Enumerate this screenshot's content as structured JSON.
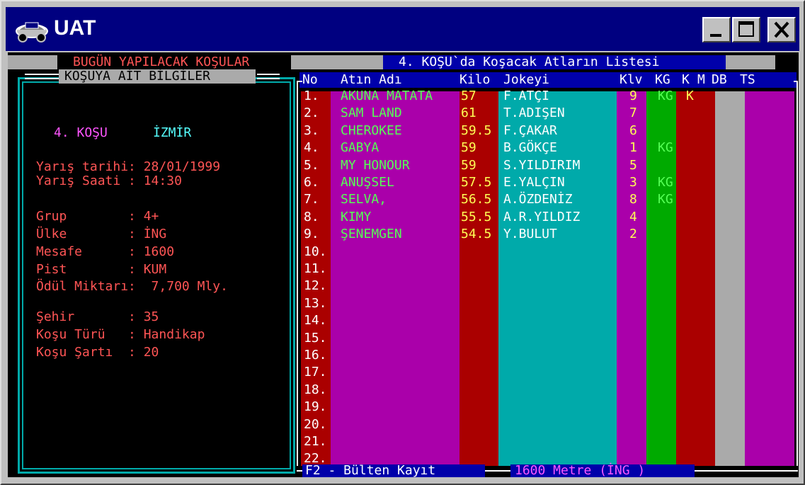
{
  "window": {
    "title": "UAT",
    "icon": "race-car-icon"
  },
  "controls": {
    "minimize_icon": "minimize-icon",
    "maximize_icon": "maximize-icon",
    "close_icon": "close-icon"
  },
  "left": {
    "header": "BUGÜN YAPILACAK KOŞULAR",
    "box_title": "KOŞUYA AİT BİLGİLER",
    "race_no": "4. KOŞU",
    "city": "İZMİR",
    "lines": [
      "Yarış tarihi: 28/01/1999",
      "Yarış Saati : 14:30",
      "",
      "Grup        : 4+",
      "Ülke        : İNG",
      "Mesafe      : 1600",
      "Pist        : KUM",
      "Ödül Miktarı:  7,700 Mly.",
      "",
      "Şehir       : 35",
      "Koşu Türü   : Handikap",
      "Koşu Şartı  : 20"
    ]
  },
  "right": {
    "header": "4. KOŞU`da Koşacak Atların Listesi",
    "columns": {
      "no": "No",
      "name": "Atın Adı",
      "kilo": "Kilo",
      "jockey": "Jokeyi",
      "klv": "Klv",
      "kg": "KG",
      "k": "K",
      "m": "M",
      "db": "DB",
      "ts": "TS"
    },
    "rows": [
      {
        "no": "1.",
        "name": "AKUNA MATATA",
        "kilo": "57",
        "jockey": "F.ATÇI",
        "klv": "9",
        "kg": "KG",
        "k": "K"
      },
      {
        "no": "2.",
        "name": "SAM LAND",
        "kilo": "61",
        "jockey": "T.ADIŞEN",
        "klv": "7",
        "kg": "",
        "k": ""
      },
      {
        "no": "3.",
        "name": "CHEROKEE",
        "kilo": "59.5",
        "jockey": "F.ÇAKAR",
        "klv": "6",
        "kg": "",
        "k": ""
      },
      {
        "no": "4.",
        "name": "GABYA",
        "kilo": "59",
        "jockey": "B.GÖKÇE",
        "klv": "1",
        "kg": "KG",
        "k": ""
      },
      {
        "no": "5.",
        "name": "MY HONOUR",
        "kilo": "59",
        "jockey": "S.YILDIRIM",
        "klv": "5",
        "kg": "",
        "k": ""
      },
      {
        "no": "6.",
        "name": "ANUŞSEL",
        "kilo": "57.5",
        "jockey": "E.YALÇIN",
        "klv": "3",
        "kg": "KG",
        "k": ""
      },
      {
        "no": "7.",
        "name": "SELVA,",
        "kilo": "56.5",
        "jockey": "A.ÖZDENİZ",
        "klv": "8",
        "kg": "KG",
        "k": ""
      },
      {
        "no": "8.",
        "name": "KIMY",
        "kilo": "55.5",
        "jockey": "A.R.YILDIZ",
        "klv": "4",
        "kg": "",
        "k": ""
      },
      {
        "no": "9.",
        "name": "ŞENEMGEN",
        "kilo": "54.5",
        "jockey": "Y.BULUT",
        "klv": "2",
        "kg": "",
        "k": ""
      },
      {
        "no": "10.",
        "name": "",
        "kilo": "",
        "jockey": "",
        "klv": "",
        "kg": "",
        "k": ""
      },
      {
        "no": "11.",
        "name": "",
        "kilo": "",
        "jockey": "",
        "klv": "",
        "kg": "",
        "k": ""
      },
      {
        "no": "12.",
        "name": "",
        "kilo": "",
        "jockey": "",
        "klv": "",
        "kg": "",
        "k": ""
      },
      {
        "no": "13.",
        "name": "",
        "kilo": "",
        "jockey": "",
        "klv": "",
        "kg": "",
        "k": ""
      },
      {
        "no": "14.",
        "name": "",
        "kilo": "",
        "jockey": "",
        "klv": "",
        "kg": "",
        "k": ""
      },
      {
        "no": "15.",
        "name": "",
        "kilo": "",
        "jockey": "",
        "klv": "",
        "kg": "",
        "k": ""
      },
      {
        "no": "16.",
        "name": "",
        "kilo": "",
        "jockey": "",
        "klv": "",
        "kg": "",
        "k": ""
      },
      {
        "no": "17.",
        "name": "",
        "kilo": "",
        "jockey": "",
        "klv": "",
        "kg": "",
        "k": ""
      },
      {
        "no": "18.",
        "name": "",
        "kilo": "",
        "jockey": "",
        "klv": "",
        "kg": "",
        "k": ""
      },
      {
        "no": "19.",
        "name": "",
        "kilo": "",
        "jockey": "",
        "klv": "",
        "kg": "",
        "k": ""
      },
      {
        "no": "20.",
        "name": "",
        "kilo": "",
        "jockey": "",
        "klv": "",
        "kg": "",
        "k": ""
      },
      {
        "no": "21.",
        "name": "",
        "kilo": "",
        "jockey": "",
        "klv": "",
        "kg": "",
        "k": ""
      },
      {
        "no": "22.",
        "name": "",
        "kilo": "",
        "jockey": "",
        "klv": "",
        "kg": "",
        "k": ""
      }
    ],
    "footer_key": "F2 - Bülten Kayıt",
    "footer_info": "1600 Metre (İNG )"
  },
  "colors": {
    "red_text": "#ff5555",
    "magenta_text": "#ff55ff",
    "cyan_text": "#55ffff",
    "green_text": "#55ff55",
    "yellow_text": "#ffff55",
    "col_no": "#aa0000",
    "col_name": "#aa00aa",
    "col_kilo": "#aa0000",
    "col_jockey": "#00aaaa",
    "col_klv": "#aa00aa",
    "col_kg": "#00aa00",
    "col_k": "#aa0000",
    "col_m": "#aa0000",
    "col_db": "#aaaaaa",
    "col_ts": "#aa00aa",
    "header_bar": "#0000aa",
    "gray_bar": "#aaaaaa"
  }
}
